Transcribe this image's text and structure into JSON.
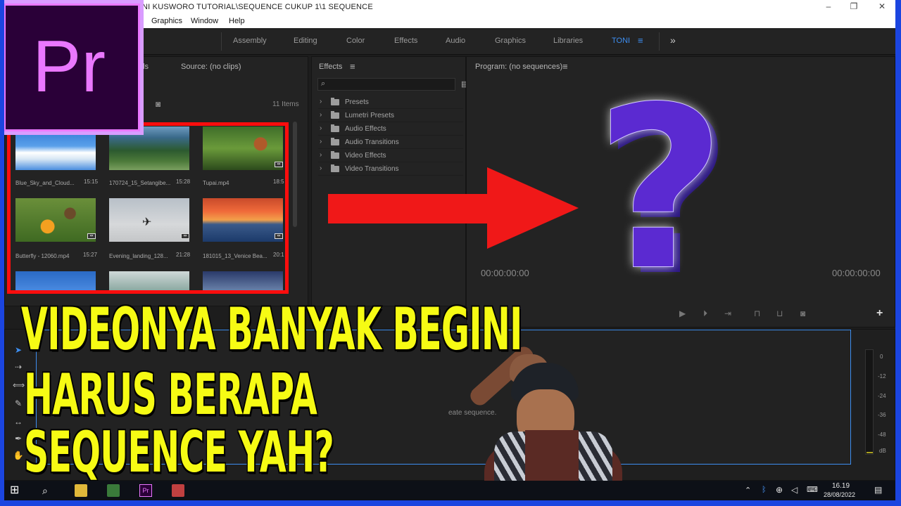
{
  "window": {
    "title": "NI KUSWORO TUTORIAL\\SEQUENCE CUKUP 1\\1 SEQUENCE"
  },
  "menu": [
    "Graphics",
    "Window",
    "Help"
  ],
  "workspaces": [
    "Assembly",
    "Editing",
    "Color",
    "Effects",
    "Audio",
    "Graphics",
    "Libraries",
    "TONI"
  ],
  "workspaces_overflow": "»",
  "project": {
    "tab_partial": "ols",
    "source_tab": "Source: (no clips)",
    "item_count": "11 Items",
    "clips": [
      {
        "name": "Blue_Sky_and_Cloud...",
        "duration": "15:15"
      },
      {
        "name": "170724_15_Setangibe...",
        "duration": "15:28"
      },
      {
        "name": "Tupai.mp4",
        "duration": "18:5"
      },
      {
        "name": "Butterfly - 12060.mp4",
        "duration": "15:27"
      },
      {
        "name": "Evening_landing_128...",
        "duration": "21:28"
      },
      {
        "name": "181015_13_Venice Bea...",
        "duration": "20:1"
      }
    ]
  },
  "effects": {
    "title": "Effects",
    "items": [
      "Presets",
      "Lumetri Presets",
      "Audio Effects",
      "Audio Transitions",
      "Video Effects",
      "Video Transitions"
    ]
  },
  "program": {
    "title": "Program: (no sequences)",
    "timecode_left": "00:00:00:00",
    "timecode_right": "00:00:00:00"
  },
  "timeline": {
    "hint_partial": "eate sequence."
  },
  "meter_scale": [
    "0",
    "-12",
    "-24",
    "-36",
    "-48",
    "dB"
  ],
  "overlay": {
    "line1": "VIDEONYA BANYAK BEGINI",
    "line2": "HARUS BERAPA",
    "line3": "SEQUENCE YAH?",
    "question_mark": "?"
  },
  "logo": {
    "text": "Pr"
  },
  "taskbar": {
    "time": "16.19",
    "date": "28/08/2022"
  },
  "colors": {
    "accent_blue": "#3d8ef0",
    "overlay_yellow": "#f6fb14",
    "red_arrow": "#f01818",
    "premiere_purple": "#ea77ff",
    "question_purple": "#5b2ad1"
  }
}
